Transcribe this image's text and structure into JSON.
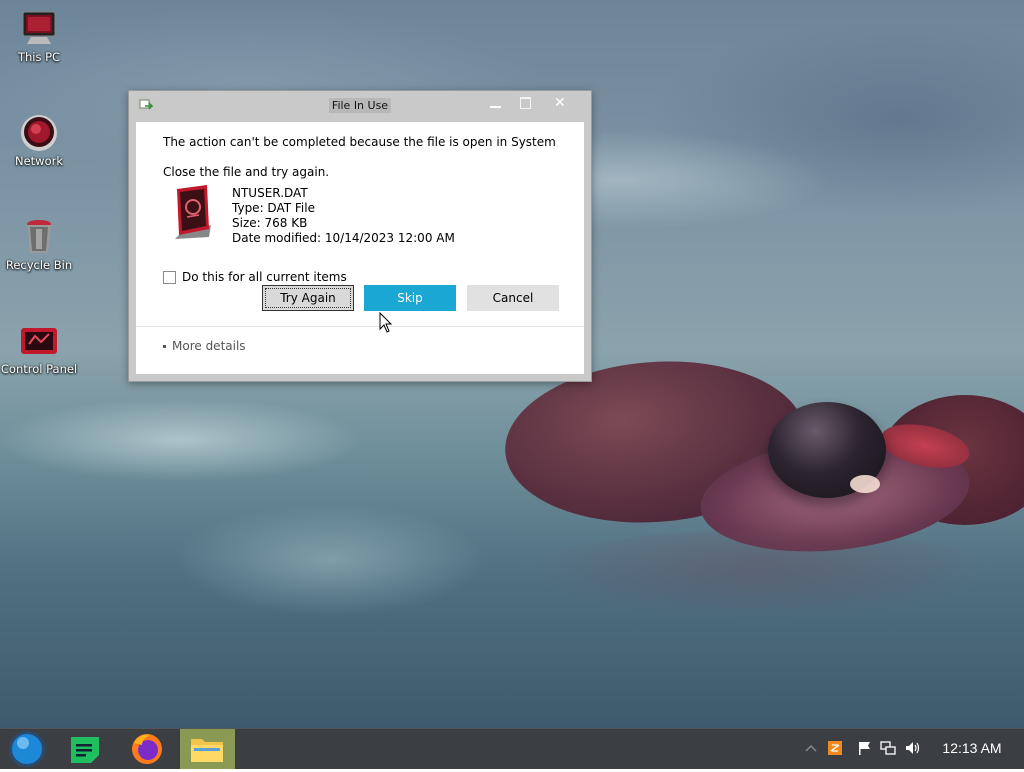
{
  "desktop": {
    "icons": [
      {
        "label": "This PC"
      },
      {
        "label": "Network"
      },
      {
        "label": "Recycle Bin"
      },
      {
        "label": "Control Panel"
      }
    ]
  },
  "dialog": {
    "title": "File In Use",
    "message": "The action can't be completed because the file is open in System",
    "instruction": "Close the file and try again.",
    "file": {
      "name": "NTUSER.DAT",
      "type": "Type: DAT File",
      "size": "Size: 768 KB",
      "modified": "Date modified: 10/14/2023 12:00 AM"
    },
    "checkbox_label": "Do this for all current items",
    "checkbox_checked": false,
    "buttons": {
      "try_again": "Try Again",
      "skip": "Skip",
      "cancel": "Cancel"
    },
    "more_details": "More details"
  },
  "taskbar": {
    "apps": [
      {
        "icon": "start-orb-icon"
      },
      {
        "icon": "notes-app-icon"
      },
      {
        "icon": "firefox-icon"
      },
      {
        "icon": "file-explorer-icon",
        "active": true
      }
    ],
    "tray": [
      "chevron-up-icon",
      "app-tray-icon",
      "flag-icon",
      "network-icon",
      "volume-icon"
    ],
    "clock": "12:13 AM"
  },
  "colors": {
    "skip_button": "#1aa7d4",
    "taskbar": "#3b3f43",
    "active_taskbar_item": "#8a9a55"
  }
}
